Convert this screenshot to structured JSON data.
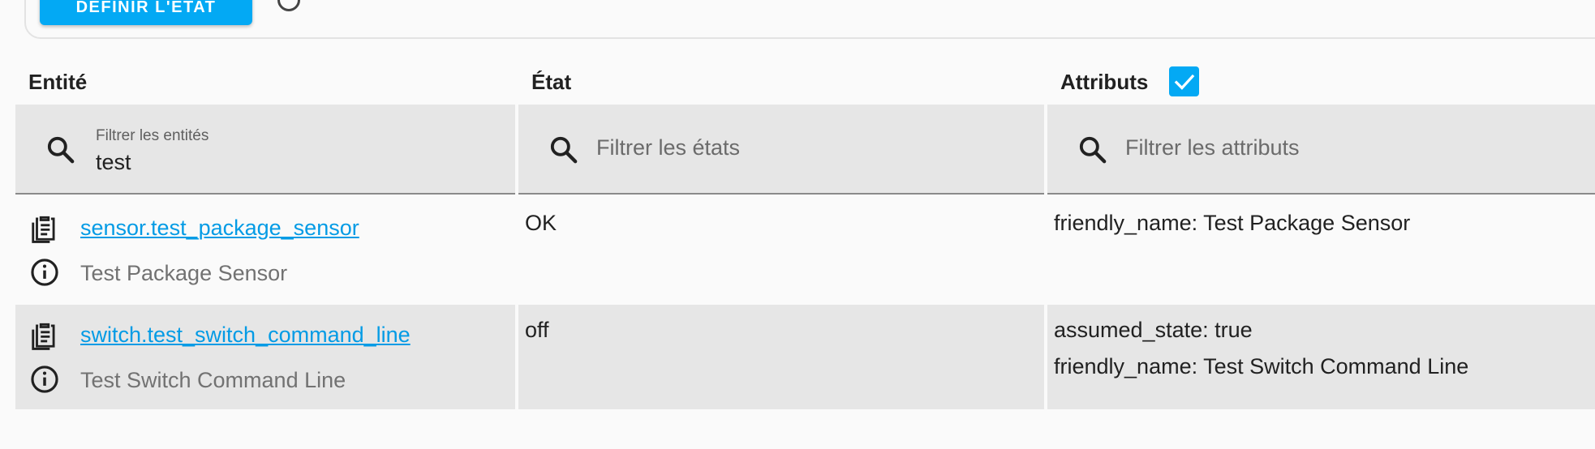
{
  "toolbar": {
    "set_state_label": "DÉFINIR L'ÉTAT"
  },
  "columns": {
    "entity": "Entité",
    "state": "État",
    "attributes": "Attributs"
  },
  "attributes_checkbox_checked": true,
  "filters": {
    "entity": {
      "label": "Filtrer les entités",
      "value": "test"
    },
    "state": {
      "placeholder": "Filtrer les états"
    },
    "attributes": {
      "placeholder": "Filtrer les attributs"
    }
  },
  "rows": [
    {
      "entity_id": "sensor.test_package_sensor",
      "friendly_name": "Test Package Sensor",
      "state": "OK",
      "attributes": [
        "friendly_name: Test Package Sensor"
      ]
    },
    {
      "entity_id": "switch.test_switch_command_line",
      "friendly_name": "Test Switch Command Line",
      "state": "off",
      "attributes": [
        "assumed_state: true",
        "friendly_name: Test Switch Command Line"
      ]
    }
  ],
  "colors": {
    "accent": "#03a9f4",
    "link": "#039be5",
    "row_alt": "#e6e6e6"
  }
}
